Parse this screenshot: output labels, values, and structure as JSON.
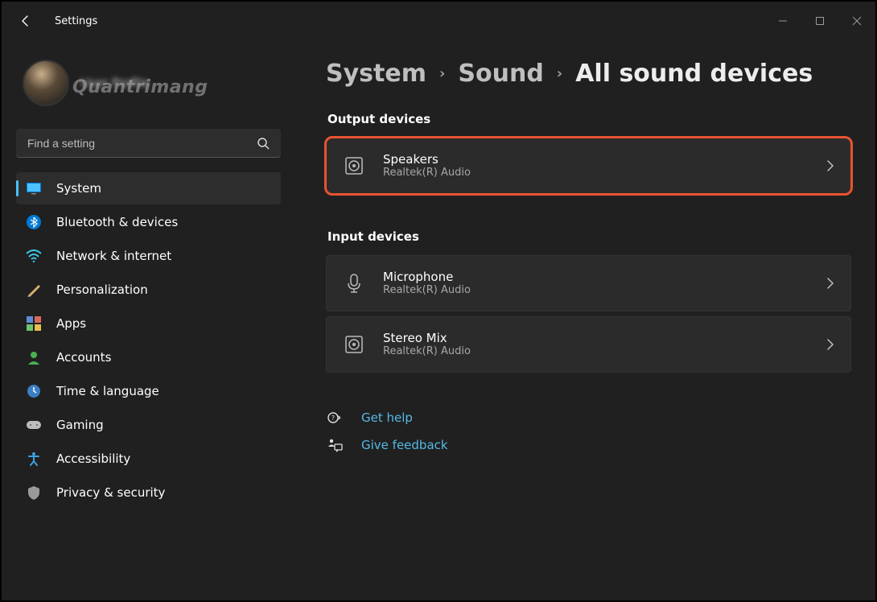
{
  "header": {
    "app_title": "Settings"
  },
  "profile": {
    "watermark": "Quantrimang",
    "name_blur": "User Profile"
  },
  "search": {
    "placeholder": "Find a setting"
  },
  "sidebar": {
    "items": [
      {
        "label": "System"
      },
      {
        "label": "Bluetooth & devices"
      },
      {
        "label": "Network & internet"
      },
      {
        "label": "Personalization"
      },
      {
        "label": "Apps"
      },
      {
        "label": "Accounts"
      },
      {
        "label": "Time & language"
      },
      {
        "label": "Gaming"
      },
      {
        "label": "Accessibility"
      },
      {
        "label": "Privacy & security"
      }
    ]
  },
  "breadcrumb": {
    "level1": "System",
    "level2": "Sound",
    "level3": "All sound devices"
  },
  "sections": {
    "output_title": "Output devices",
    "input_title": "Input devices"
  },
  "output_devices": [
    {
      "name": "Speakers",
      "sub": "Realtek(R) Audio"
    }
  ],
  "input_devices": [
    {
      "name": "Microphone",
      "sub": "Realtek(R) Audio"
    },
    {
      "name": "Stereo Mix",
      "sub": "Realtek(R) Audio"
    }
  ],
  "links": {
    "help": "Get help",
    "feedback": "Give feedback"
  },
  "colors": {
    "accent": "#4cc2ff",
    "link": "#55b9e6",
    "highlight": "#e8532f"
  }
}
